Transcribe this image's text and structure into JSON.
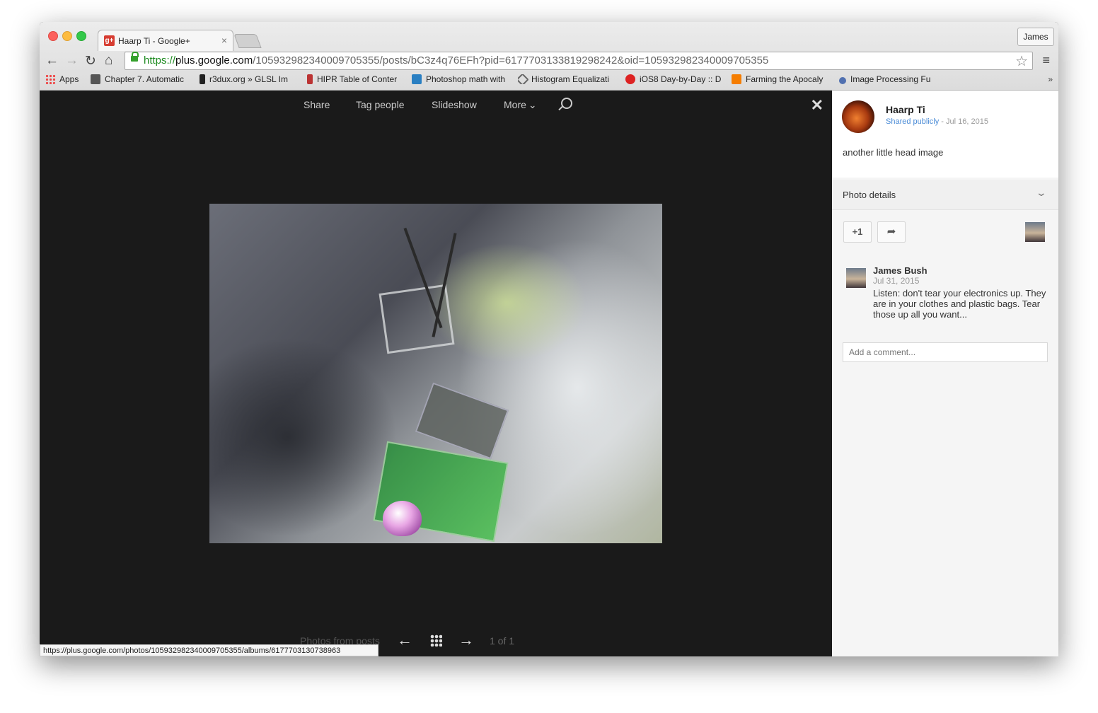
{
  "browser": {
    "tab_title": "Haarp Ti - Google+",
    "tab_close": "×",
    "favicon_text": "g+",
    "profile": "James",
    "url_scheme": "https://",
    "url_host": "plus.google.com",
    "url_path": "/105932982340009705355/posts/bC3z4q76EFh?pid=6177703133819298242&oid=105932982340009705355",
    "nav": {
      "back": "←",
      "forward": "→",
      "reload": "↻",
      "home": "⌂",
      "star": "☆",
      "menu": "≡"
    },
    "bookmarks": [
      {
        "label": "Apps",
        "icon": "apps-grid-icon",
        "color": "#e44"
      },
      {
        "label": "Chapter 7. Automatic",
        "icon": "page-thumbnail-icon",
        "color": "#555"
      },
      {
        "label": "r3dux.org » GLSL Im",
        "icon": "r3dux-icon",
        "color": "#222"
      },
      {
        "label": "HIPR Table of Conter",
        "icon": "hipr-icon",
        "color": "#b33"
      },
      {
        "label": "Photoshop math with",
        "icon": "wordpress-icon",
        "color": "#2a7fc2"
      },
      {
        "label": "Histogram Equalizati",
        "icon": "diamond-icon",
        "color": "#666"
      },
      {
        "label": "iOS8 Day-by-Day :: D",
        "icon": "sale-badge-icon",
        "color": "#d22"
      },
      {
        "label": "Farming the Apocaly",
        "icon": "blogger-icon",
        "color": "#f57d00"
      },
      {
        "label": "Image Processing Fu",
        "icon": "globe-icon",
        "color": "#5070b0"
      }
    ],
    "bookmarks_more": "»",
    "status_url": "https://plus.google.com/photos/105932982340009705355/albums/6177703130738963"
  },
  "viewer": {
    "toolbar": [
      "Share",
      "Tag people",
      "Slideshow",
      "More"
    ],
    "more_caret": "⌄",
    "close": "✕",
    "photos_from": "Photos from posts",
    "prev": "←",
    "next": "→",
    "count": "1 of 1"
  },
  "post": {
    "author": "Haarp Ti",
    "visibility": "Shared publicly",
    "date": " - Jul 16, 2015",
    "text": "another little head image",
    "details_label": "Photo details",
    "details_chevron": "⌄",
    "plusone": "+1",
    "share_glyph": "➦",
    "comment": {
      "name": "James Bush",
      "date": "Jul 31, 2015",
      "text": "Listen: don't tear your electronics up. They are in your clothes and plastic bags. Tear those up all you want..."
    },
    "comment_placeholder": "Add a comment..."
  }
}
